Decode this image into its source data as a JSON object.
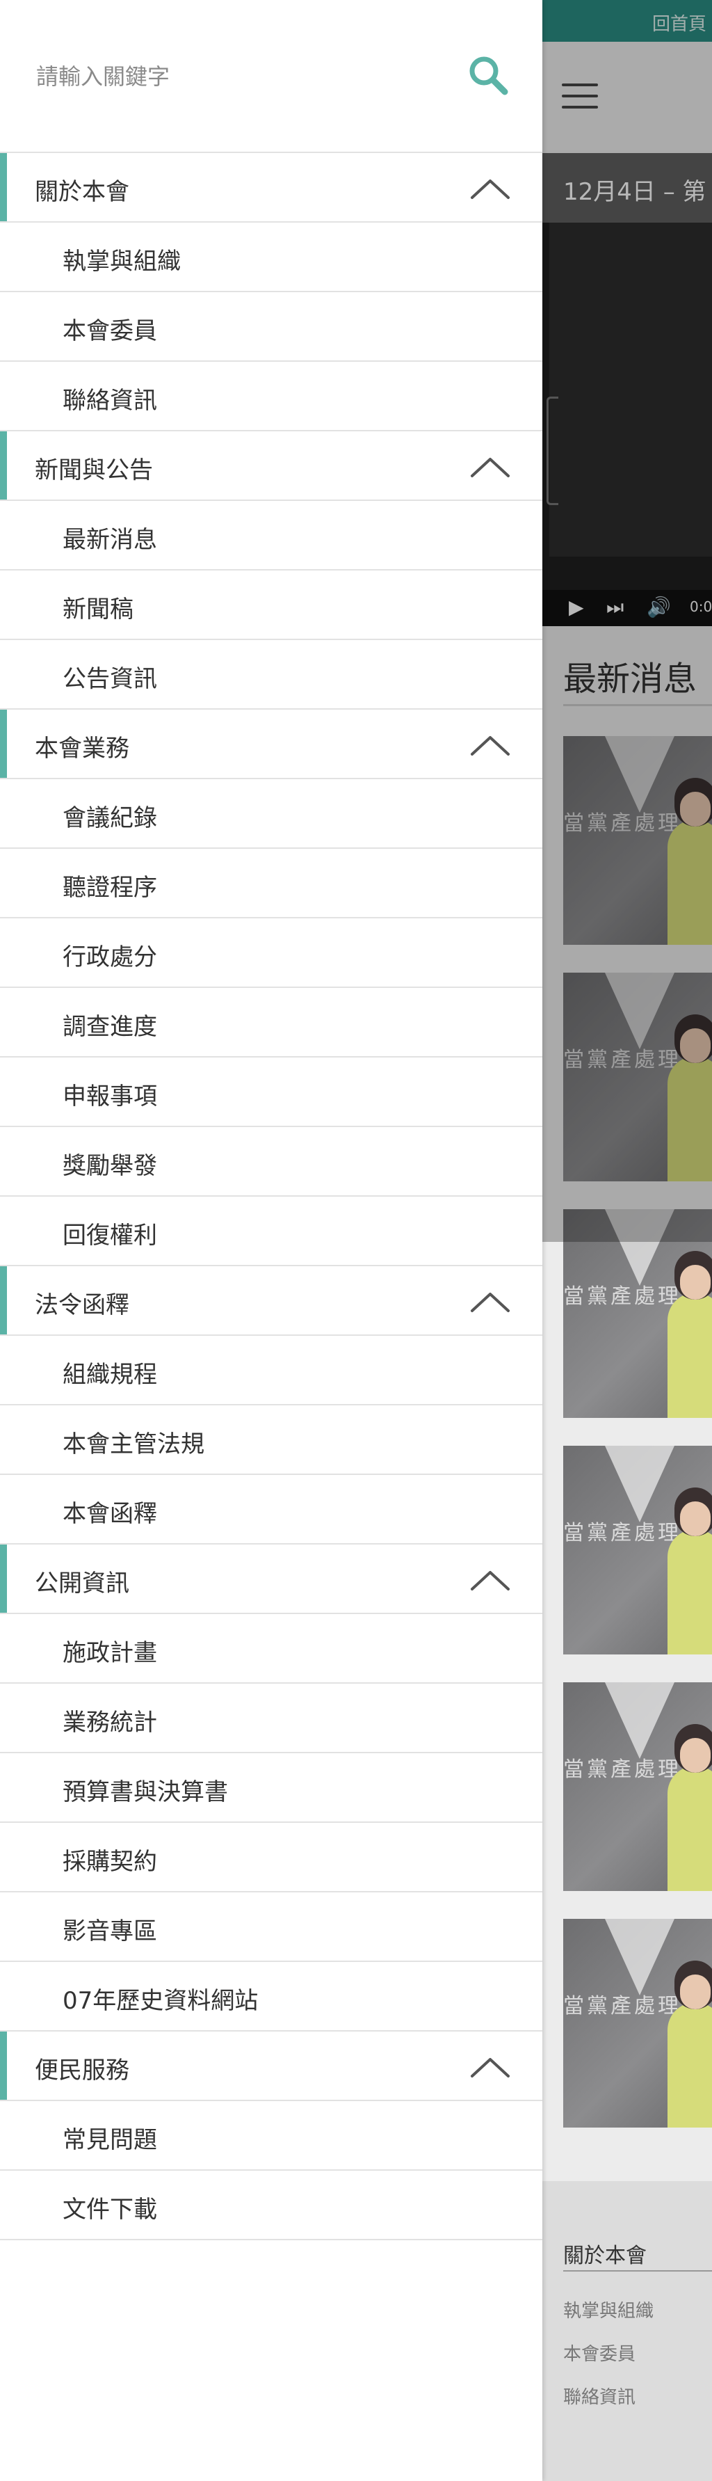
{
  "search": {
    "placeholder": "請輸入關鍵字"
  },
  "topbar": {
    "link": "回首頁"
  },
  "video": {
    "title": "12月4日 – 第",
    "time": "0:0"
  },
  "news": {
    "title": "最新消息",
    "thumb_text": "當黨產處理委"
  },
  "footer": {
    "title": "關於本會",
    "links": [
      "執掌與組織",
      "本會委員",
      "聯絡資訊"
    ]
  },
  "menu": [
    {
      "label": "關於本會",
      "children": [
        "執掌與組織",
        "本會委員",
        "聯絡資訊"
      ]
    },
    {
      "label": "新聞與公告",
      "children": [
        "最新消息",
        "新聞稿",
        "公告資訊"
      ]
    },
    {
      "label": "本會業務",
      "children": [
        "會議紀錄",
        "聽證程序",
        "行政處分",
        "調查進度",
        "申報事項",
        "獎勵舉發",
        "回復權利"
      ]
    },
    {
      "label": "法令函釋",
      "children": [
        "組織規程",
        "本會主管法規",
        "本會函釋"
      ]
    },
    {
      "label": "公開資訊",
      "children": [
        "施政計畫",
        "業務統計",
        "預算書與決算書",
        "採購契約",
        "影音專區",
        "07年歷史資料網站"
      ]
    },
    {
      "label": "便民服務",
      "children": [
        "常見問題",
        "文件下載"
      ]
    }
  ],
  "colors": {
    "accent": "#5bb3a6",
    "topbar": "#2a8d83"
  }
}
